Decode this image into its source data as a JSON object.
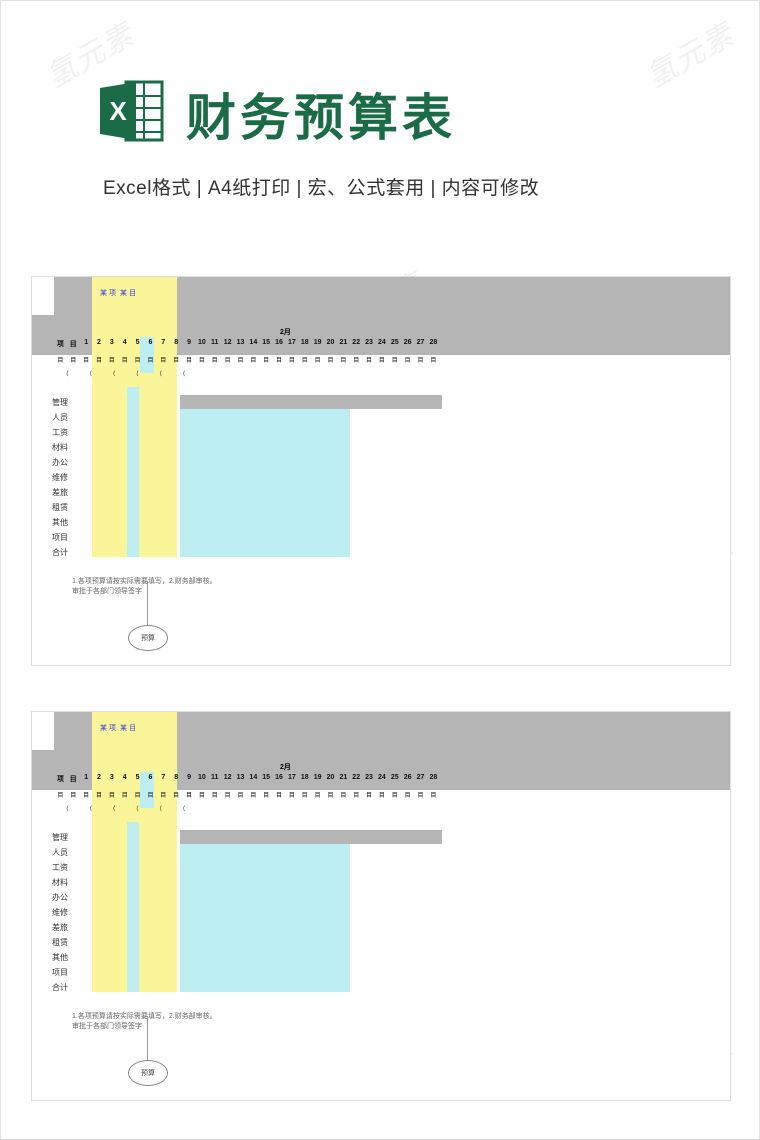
{
  "header": {
    "title": "财务预算表",
    "subtitle": "Excel格式 |  A4纸打印 | 宏、公式套用 | 内容可修改"
  },
  "watermark_text": "氢元素",
  "sheet": {
    "top_blue_a": "某 项",
    "top_blue_b": "某 目",
    "center_label": "2月",
    "row_labels": [
      "管理",
      "人员",
      "工资",
      "材料",
      "办公",
      "维修",
      "差旅",
      "租赁",
      "其他",
      "项目",
      "合计"
    ],
    "note_line1": "1.各项预算请按实际需要填写，2.财务部审核。",
    "note_line2": "审批于各部门领导签字",
    "tab_label": "预算"
  }
}
